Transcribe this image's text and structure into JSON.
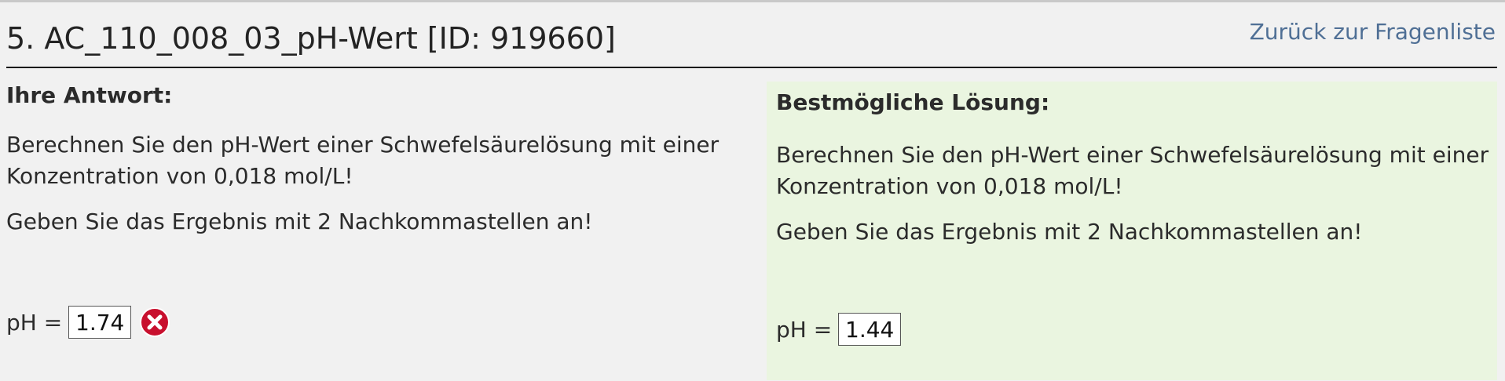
{
  "header": {
    "title": "5. AC_110_008_03_pH-Wert [ID: 919660]",
    "back_link": "Zurück zur Fragenliste"
  },
  "your_answer": {
    "heading": "Ihre Antwort:",
    "question_line1": "Berechnen Sie den pH-Wert einer Schwefelsäurelösung mit einer Konzentration von 0,018 mol/L!",
    "question_line2": "Geben Sie das Ergebnis mit 2 Nachkommastellen an!",
    "ph_label": "pH =",
    "ph_value": "1.74",
    "result_icon": "wrong-icon",
    "result_color": "#c8102e"
  },
  "best_solution": {
    "heading": "Bestmögliche Lösung:",
    "question_line1": "Berechnen Sie den pH-Wert einer Schwefelsäurelösung mit einer Konzentration von 0,018 mol/L!",
    "question_line2": "Geben Sie das Ergebnis mit 2 Nachkommastellen an!",
    "ph_label": "pH =",
    "ph_value": "1.44",
    "background_color": "#eaf5e0"
  },
  "colors": {
    "link": "#4f6f95",
    "page_background": "#f1f1f1"
  }
}
